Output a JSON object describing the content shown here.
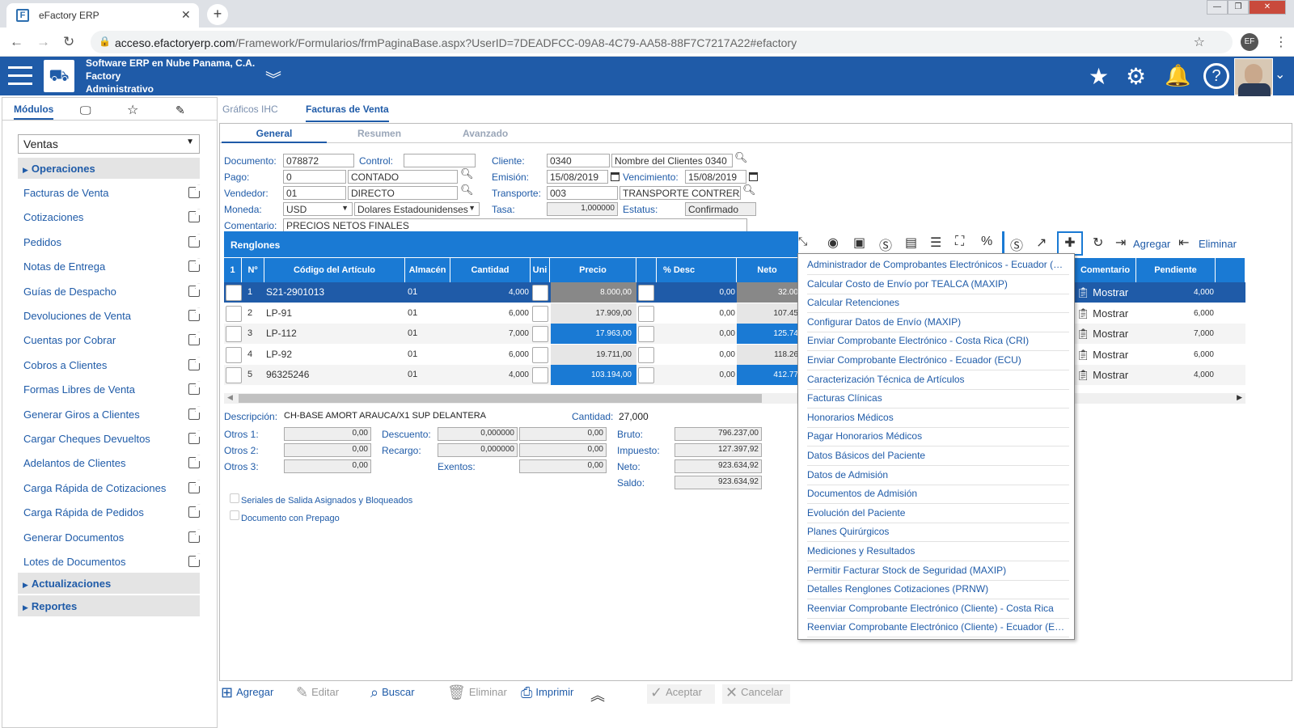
{
  "browser": {
    "tab_title": "eFactory ERP",
    "url_host": "acceso.efactoryerp.com",
    "url_path": "/Framework/Formularios/frmPaginaBase.aspx?UserID=7DEADFCC-09A8-4C79-AA58-88F7C7217A22#efactory",
    "profile_initials": "EF"
  },
  "header": {
    "company_line1": "Software ERP en Nube Panama, C.A.",
    "company_line2": "Factory",
    "company_line3": "Administrativo"
  },
  "sidebar": {
    "tab_modules": "Módulos",
    "module_selected": "Ventas",
    "section_operaciones": "Operaciones",
    "items": [
      {
        "label": "Facturas de Venta"
      },
      {
        "label": "Cotizaciones"
      },
      {
        "label": "Pedidos"
      },
      {
        "label": "Notas de Entrega"
      },
      {
        "label": "Guías de Despacho"
      },
      {
        "label": "Devoluciones de Venta"
      },
      {
        "label": "Cuentas por Cobrar"
      },
      {
        "label": "Cobros a Clientes"
      },
      {
        "label": "Formas Libres de Venta"
      },
      {
        "label": "Generar Giros a Clientes"
      },
      {
        "label": "Cargar Cheques Devueltos"
      },
      {
        "label": "Adelantos de Clientes"
      },
      {
        "label": "Carga Rápida de Cotizaciones"
      },
      {
        "label": "Carga Rápida de Pedidos"
      },
      {
        "label": "Generar Documentos"
      },
      {
        "label": "Lotes de Documentos"
      }
    ],
    "section_actualizaciones": "Actualizaciones",
    "section_reportes": "Reportes"
  },
  "main": {
    "tab_graficos": "Gráficos IHC",
    "tab_facturas": "Facturas de Venta",
    "subtab_general": "General",
    "subtab_resumen": "Resumen",
    "subtab_avanzado": "Avanzado"
  },
  "form": {
    "documento_label": "Documento:",
    "documento": "078872",
    "control_label": "Control:",
    "control": "",
    "cliente_label": "Cliente:",
    "cliente_code": "0340",
    "cliente_name": "Nombre del Clientes 0340",
    "pago_label": "Pago:",
    "pago_code": "0",
    "pago_name": "CONTADO",
    "emision_label": "Emisión:",
    "emision": "15/08/2019",
    "vencimiento_label": "Vencimiento:",
    "vencimiento": "15/08/2019",
    "vendedor_label": "Vendedor:",
    "vendedor_code": "01",
    "vendedor_name": "DIRECTO",
    "transporte_label": "Transporte:",
    "transporte_code": "003",
    "transporte_name": "TRANSPORTE CONTRERAS",
    "moneda_label": "Moneda:",
    "moneda_code": "USD",
    "moneda_name": "Dolares Estadounidenses",
    "tasa_label": "Tasa:",
    "tasa": "1,000000",
    "estatus_label": "Estatus:",
    "estatus": "Confirmado",
    "comentario_label": "Comentario:",
    "comentario": "PRECIOS NETOS FINALES"
  },
  "grid": {
    "title": "Renglones",
    "toolbar_add": "Agregar",
    "toolbar_delete": "Eliminar",
    "columns": {
      "c1": "1",
      "num": "Nº",
      "codigo": "Código del Artículo",
      "almacen": "Almacén",
      "cantidad": "Cantidad",
      "uni": "Uni",
      "precio": "Precio",
      "desc": "% Desc",
      "neto": "Neto",
      "comentario": "Comentario",
      "pendiente": "Pendiente"
    },
    "rows": [
      {
        "n": "1",
        "codigo": "S21-2901013",
        "almacen": "01",
        "cantidad": "4,000",
        "precio": "8.000,00",
        "desc": "0,00",
        "neto": "32.00",
        "comentario": "Mostrar",
        "pendiente": "4,000"
      },
      {
        "n": "2",
        "codigo": "LP-91",
        "almacen": "01",
        "cantidad": "6,000",
        "precio": "17.909,00",
        "desc": "0,00",
        "neto": "107.45",
        "comentario": "Mostrar",
        "pendiente": "6,000"
      },
      {
        "n": "3",
        "codigo": "LP-112",
        "almacen": "01",
        "cantidad": "7,000",
        "precio": "17.963,00",
        "desc": "0,00",
        "neto": "125.74",
        "comentario": "Mostrar",
        "pendiente": "7,000"
      },
      {
        "n": "4",
        "codigo": "LP-92",
        "almacen": "01",
        "cantidad": "6,000",
        "precio": "19.711,00",
        "desc": "0,00",
        "neto": "118.26",
        "comentario": "Mostrar",
        "pendiente": "6,000"
      },
      {
        "n": "5",
        "codigo": "96325246",
        "almacen": "01",
        "cantidad": "4,000",
        "precio": "103.194,00",
        "desc": "0,00",
        "neto": "412.77",
        "comentario": "Mostrar",
        "pendiente": "4,000"
      }
    ]
  },
  "dropdown": {
    "items": [
      "Administrador de Comprobantes Electrónicos - Ecuador (ECU)",
      "Calcular Costo de Envío por TEALCA (MAXIP)",
      "Calcular Retenciones",
      "Configurar Datos de Envío (MAXIP)",
      "Enviar Comprobante Electrónico - Costa Rica (CRI)",
      "Enviar Comprobante Electrónico - Ecuador (ECU)",
      "Caracterización Técnica de Artículos",
      "Facturas Clínicas",
      "Honorarios Médicos",
      "Pagar Honorarios Médicos",
      "Datos Básicos del Paciente",
      "Datos de Admisión",
      "Documentos de Admisión",
      "Evolución del Paciente",
      "Planes Quirúrgicos",
      "Mediciones y Resultados",
      "Permitir Facturar Stock de Seguridad (MAXIP)",
      "Detalles Renglones Cotizaciones (PRNW)",
      "Reenviar Comprobante Electrónico (Cliente) - Costa Rica",
      "Reenviar Comprobante Electrónico (Cliente) - Ecuador (ECU)"
    ]
  },
  "totals": {
    "descripcion_label": "Descripción:",
    "descripcion": "CH-BASE AMORT ARAUCA/X1 SUP DELANTERA",
    "cantidad_label": "Cantidad:",
    "cantidad": "27,000",
    "otros1_label": "Otros 1:",
    "otros1": "0,00",
    "otros2_label": "Otros 2:",
    "otros2": "0,00",
    "otros3_label": "Otros 3:",
    "otros3": "0,00",
    "descuento_label": "Descuento:",
    "descuento_pct": "0,000000",
    "descuento": "0,00",
    "recargo_label": "Recargo:",
    "recargo_pct": "0,000000",
    "recargo": "0,00",
    "exentos_label": "Exentos:",
    "exentos": "0,00",
    "bruto_label": "Bruto:",
    "bruto": "796.237,00",
    "impuesto_label": "Impuesto:",
    "impuesto": "127.397,92",
    "neto_label": "Neto:",
    "neto": "923.634,92",
    "saldo_label": "Saldo:",
    "saldo": "923.634,92",
    "check_seriales": "Seriales de Salida Asignados y Bloqueados",
    "check_prepago": "Documento con Prepago"
  },
  "footer": {
    "agregar": "Agregar",
    "editar": "Editar",
    "buscar": "Buscar",
    "eliminar": "Eliminar",
    "imprimir": "Imprimir",
    "aceptar": "Aceptar",
    "cancelar": "Cancelar"
  }
}
